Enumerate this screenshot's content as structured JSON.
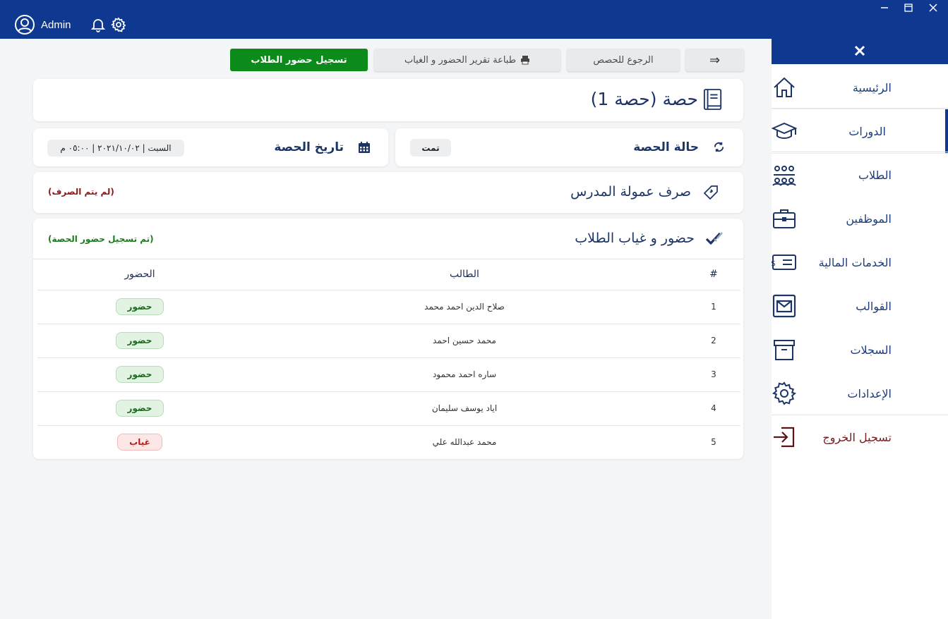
{
  "colors": {
    "brand": "#0f3991",
    "green": "#0c8a1a",
    "present": "#1d6b1d",
    "absent": "#b31b1b",
    "unpaid": "#8a1a1a"
  },
  "topbar": {
    "user_name": "Admin"
  },
  "sidebar": {
    "items": [
      {
        "label": "الرئيسية",
        "icon": "home-icon"
      },
      {
        "label": "الدورات",
        "icon": "graduation-cap-icon"
      },
      {
        "label": "الطلاب",
        "icon": "students-group-icon"
      },
      {
        "label": "الموظفين",
        "icon": "briefcase-icon"
      },
      {
        "label": "الخدمات المالية",
        "icon": "money-bill-icon"
      },
      {
        "label": "القوالب",
        "icon": "envelope-icon"
      },
      {
        "label": "السجلات",
        "icon": "archive-box-icon"
      },
      {
        "label": "الإعدادات",
        "icon": "gear-icon"
      },
      {
        "label": "تسجيل الخروج",
        "icon": "logout-icon"
      }
    ]
  },
  "toolbar": {
    "back_arrow": "⇒",
    "back_to_sessions": "الرجوع للحصص",
    "print_report": "طباعة تقرير الحضور و الغياب",
    "record_attendance": "تسجيل حضور الطلاب"
  },
  "session": {
    "title": "حصة (حصة 1)",
    "status_label": "حالة الحصة",
    "status_value": "تمت",
    "date_label": "تاريخ الحصة",
    "date_value": "السبت | ٢٠٢١/١٠/٠٢ | ٠٥:٠٠ م",
    "commission_label": "صرف عمولة المدرس",
    "commission_status": "(لم يتم الصرف)",
    "attendance_label": "حضور و غياب الطلاب",
    "attendance_status": "(تم تسجيل حضور الحصة)"
  },
  "table": {
    "headers": {
      "num": "#",
      "student": "الطالب",
      "attendance": "الحضور"
    },
    "rows": [
      {
        "num": "1",
        "student": "صلاح الدين احمد محمد",
        "status": "حضور",
        "type": "present"
      },
      {
        "num": "2",
        "student": "محمد حسين احمد",
        "status": "حضور",
        "type": "present"
      },
      {
        "num": "3",
        "student": "ساره احمد محمود",
        "status": "حضور",
        "type": "present"
      },
      {
        "num": "4",
        "student": "اياد يوسف سليمان",
        "status": "حضور",
        "type": "present"
      },
      {
        "num": "5",
        "student": "محمد عبدالله علي",
        "status": "غياب",
        "type": "absent"
      }
    ]
  }
}
